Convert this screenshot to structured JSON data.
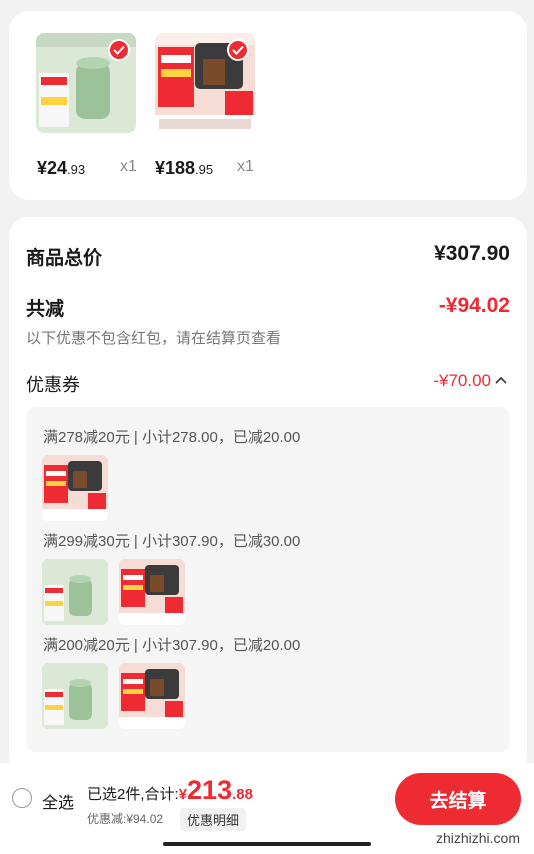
{
  "products": [
    {
      "price_int": "¥24",
      "price_dec": ".93",
      "qty": "x1",
      "thumb": "green humidifier",
      "selected": true
    },
    {
      "price_int": "¥188",
      "price_dec": ".95",
      "qty": "x1",
      "thumb": "coffee machine",
      "selected": true
    }
  ],
  "summary": {
    "total_label": "商品总价",
    "total_value": "¥307.90",
    "discount_label": "共减",
    "discount_value": "-¥94.02",
    "discount_note": "以下优惠不包含红包，请在结算页查看",
    "coupon_label": "优惠券",
    "coupon_value": "-¥70.00"
  },
  "coupons": [
    {
      "text": "满278减20元 | 小计278.00，已减20.00",
      "items": [
        "coffee machine"
      ]
    },
    {
      "text": "满299减30元 | 小计307.90，已减30.00",
      "items": [
        "green humidifier",
        "coffee machine"
      ]
    },
    {
      "text": "满200减20元 | 小计307.90，已减20.00",
      "items": [
        "green humidifier",
        "coffee machine"
      ]
    }
  ],
  "bottom": {
    "select_all": "全选",
    "selected_text": "已选2件,合计:",
    "yen": "¥",
    "total_int": "213",
    "total_dec": ".88",
    "discount_text": "优惠减:¥94.02",
    "detail_button": "优惠明细",
    "checkout_button": "去结算"
  },
  "watermark": "zhizhizhi.com",
  "colors": {
    "accent": "#ee2a33",
    "humidifier_green": "#9cc29a",
    "machine_dark": "#3b3b3b"
  }
}
